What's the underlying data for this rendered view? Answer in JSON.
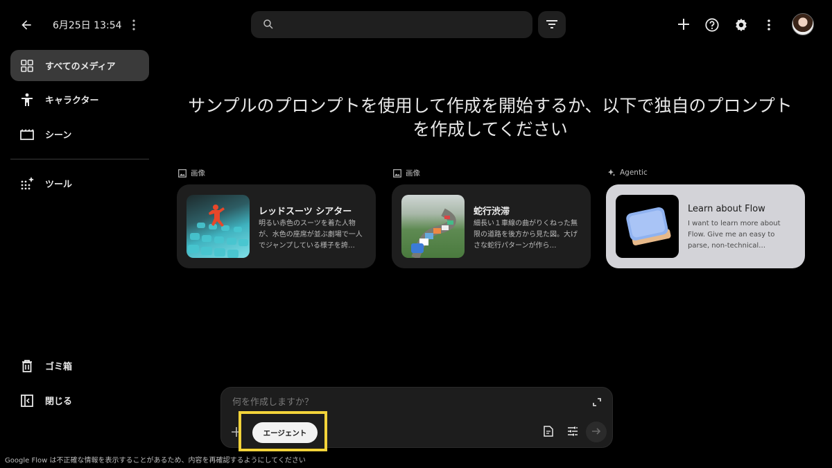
{
  "header": {
    "date": "6月25日 13:54",
    "search_placeholder": ""
  },
  "sidebar": {
    "items": [
      {
        "label": "すべてのメディア",
        "icon": "grid-icon",
        "active": true
      },
      {
        "label": "キャラクター",
        "icon": "person-icon"
      },
      {
        "label": "シーン",
        "icon": "clapper-icon"
      },
      {
        "label": "ツール",
        "icon": "sparkle-grid-icon"
      },
      {
        "label": "ゴミ箱",
        "icon": "trash-icon"
      },
      {
        "label": "閉じる",
        "icon": "collapse-sidebar-icon"
      }
    ]
  },
  "main": {
    "headline_line1": "サンプルのプロンプトを使用して作成を開始するか、以下で独自のプロンプト",
    "headline_line2": "を作成してください",
    "cards": [
      {
        "tag": "画像",
        "title": "レッドスーツ シアター",
        "desc": "明るい赤色のスーツを着た人物が、水色の座席が並ぶ劇場で一人でジャンプしている様子を誇…"
      },
      {
        "tag": "画像",
        "title": "蛇行渋滞",
        "desc": "細長い１車線の曲がりくねった無限の道路を後方から見た図。大げさな蛇行パターンが作ら…"
      },
      {
        "tag": "Agentic",
        "title": "Learn about Flow",
        "desc": "I want to learn more about Flow. Give me an easy to parse, non-technical…"
      }
    ]
  },
  "prompt": {
    "placeholder": "何を作成しますか？",
    "agent_label": "エージェント"
  },
  "footer": {
    "disclaimer": "Google Flow は不正確な情報を表示することがあるため、内容を再確認するようにしてください"
  },
  "colors": {
    "highlight": "#f2d33a",
    "active_nav": "#3a3a3a"
  }
}
